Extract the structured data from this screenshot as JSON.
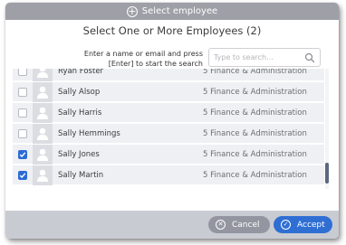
{
  "dialog": {
    "title": "Select employee",
    "heading": "Select One or More Employees (2)",
    "instructions_line1": "Enter a name or email and press",
    "instructions_line2": "[Enter] to start the search",
    "search": {
      "placeholder": "Type to search...",
      "value": ""
    },
    "rows": [
      {
        "name": "Ryan Foster",
        "department": "5 Finance & Administration",
        "checked": false
      },
      {
        "name": "Sally Alsop",
        "department": "5 Finance & Administration",
        "checked": false
      },
      {
        "name": "Sally Harris",
        "department": "5 Finance & Administration",
        "checked": false
      },
      {
        "name": "Sally Hemmings",
        "department": "5 Finance & Administration",
        "checked": false
      },
      {
        "name": "Sally Jones",
        "department": "5 Finance & Administration",
        "checked": true
      },
      {
        "name": "Sally Martin",
        "department": "5 Finance & Administration",
        "checked": true
      }
    ],
    "cancel_label": "Cancel",
    "accept_label": "Accept",
    "colors": {
      "accent": "#2f6fd4",
      "titlebar": "#9e9fa7",
      "footer": "#c9cbd2",
      "cancel": "#9396a0"
    }
  }
}
